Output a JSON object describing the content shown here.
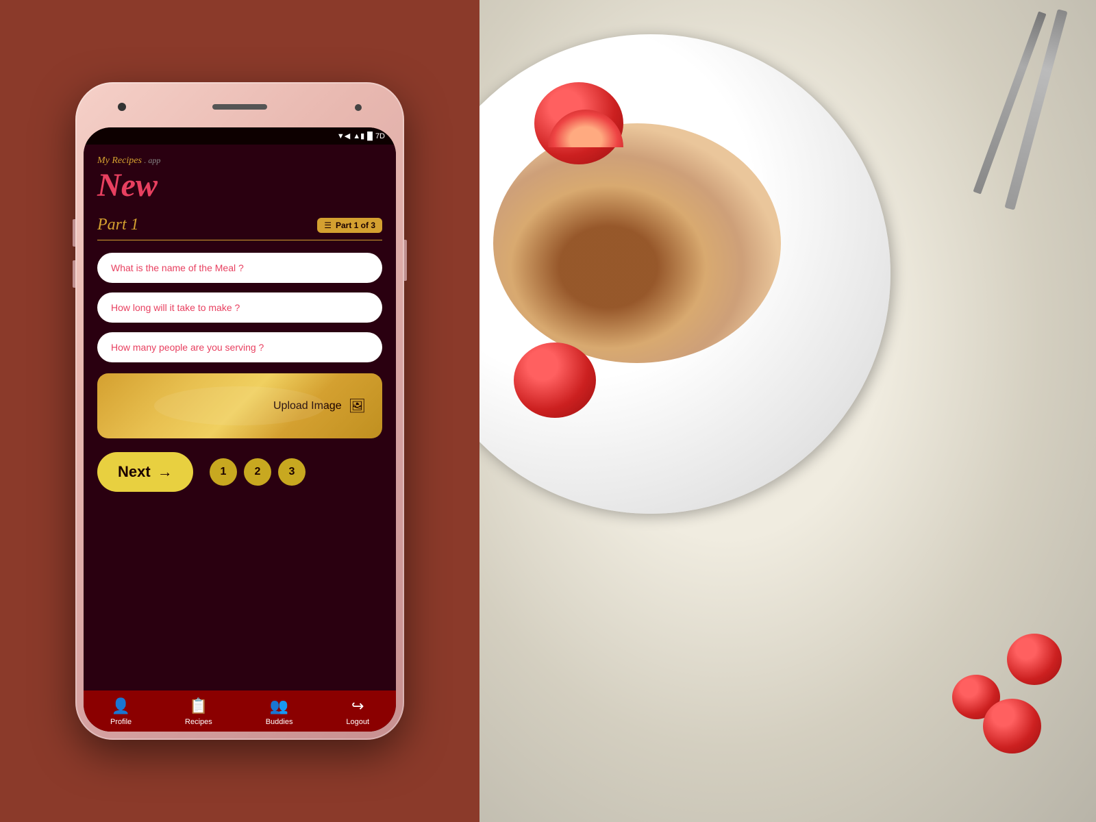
{
  "app": {
    "brand": "My Recipes",
    "brand_suffix": ". app",
    "title_new": "New",
    "part_title": "Part 1",
    "part_progress": "Part 1 of 3"
  },
  "form": {
    "field1_placeholder": "What is the name of the Meal ?",
    "field2_placeholder": "How long will it take to make ?",
    "field3_placeholder": "How many people are you serving ?"
  },
  "upload": {
    "label": "Upload Image",
    "icon": "🖼"
  },
  "navigation": {
    "next_label": "Next",
    "next_arrow": "→",
    "steps": [
      "1",
      "2",
      "3"
    ]
  },
  "bottom_nav": {
    "items": [
      {
        "id": "profile",
        "label": "Profile",
        "icon": "👤"
      },
      {
        "id": "recipes",
        "label": "Recipes",
        "icon": "📋"
      },
      {
        "id": "buddies",
        "label": "Buddies",
        "icon": "👥"
      },
      {
        "id": "logout",
        "label": "Logout",
        "icon": "🚪"
      }
    ]
  },
  "status_bar": {
    "wifi": "▼",
    "signal": "▲",
    "battery": "█",
    "time": "7D"
  },
  "colors": {
    "background_left": "#8B3A2A",
    "app_bg": "#2a0010",
    "brand_color": "#d4a030",
    "title_color": "#e84060",
    "bottom_nav": "#8B0000"
  }
}
